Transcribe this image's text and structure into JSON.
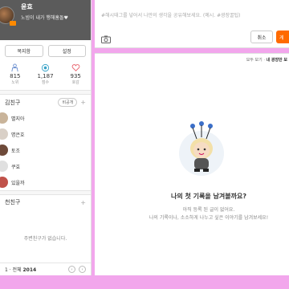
{
  "profile": {
    "name": "윤효",
    "status": "노빔이 내가 행해훔돌♥",
    "buttons": [
      "복지함",
      "설정"
    ]
  },
  "stats": [
    {
      "icon": "people-icon",
      "num": "815",
      "label": "노위"
    },
    {
      "icon": "coin-icon",
      "num": "1,187",
      "label": "점수"
    },
    {
      "icon": "heart-pulse-icon",
      "num": "935",
      "label": "호감"
    }
  ],
  "friends_section": {
    "title": "김친구",
    "chip": "비공개",
    "items": [
      "별지아",
      "명은호",
      "토조",
      "쿠효",
      "있을까"
    ]
  },
  "recommend_section": {
    "title": "천친구",
    "empty": "주변친구가 없습니다."
  },
  "pager": {
    "text": "1 · 전체 2014",
    "current": "1",
    "sep": " · 전체 ",
    "total": "2014"
  },
  "compose": {
    "placeholder": "#해시태그를 넣어서 나만의 생각을 공유해보세요. (예시. #광장꿀팁)",
    "cancel": "취소",
    "submit": "게"
  },
  "feed": {
    "filter_all": "모두 보기 ·",
    "filter_selected": "내 광장만 보",
    "empty_title": "나의 첫 기록을 남겨볼까요?",
    "empty_line1": "아직 등록 된 글이 없어요.",
    "empty_line2": "나의 기록이나, 소소하게 나누고 싶은 이야기를 남겨보세요!"
  },
  "colors": {
    "background": "#f2a6ec",
    "accent": "#ff6a00",
    "profile_bg": "#5b5b5b"
  }
}
